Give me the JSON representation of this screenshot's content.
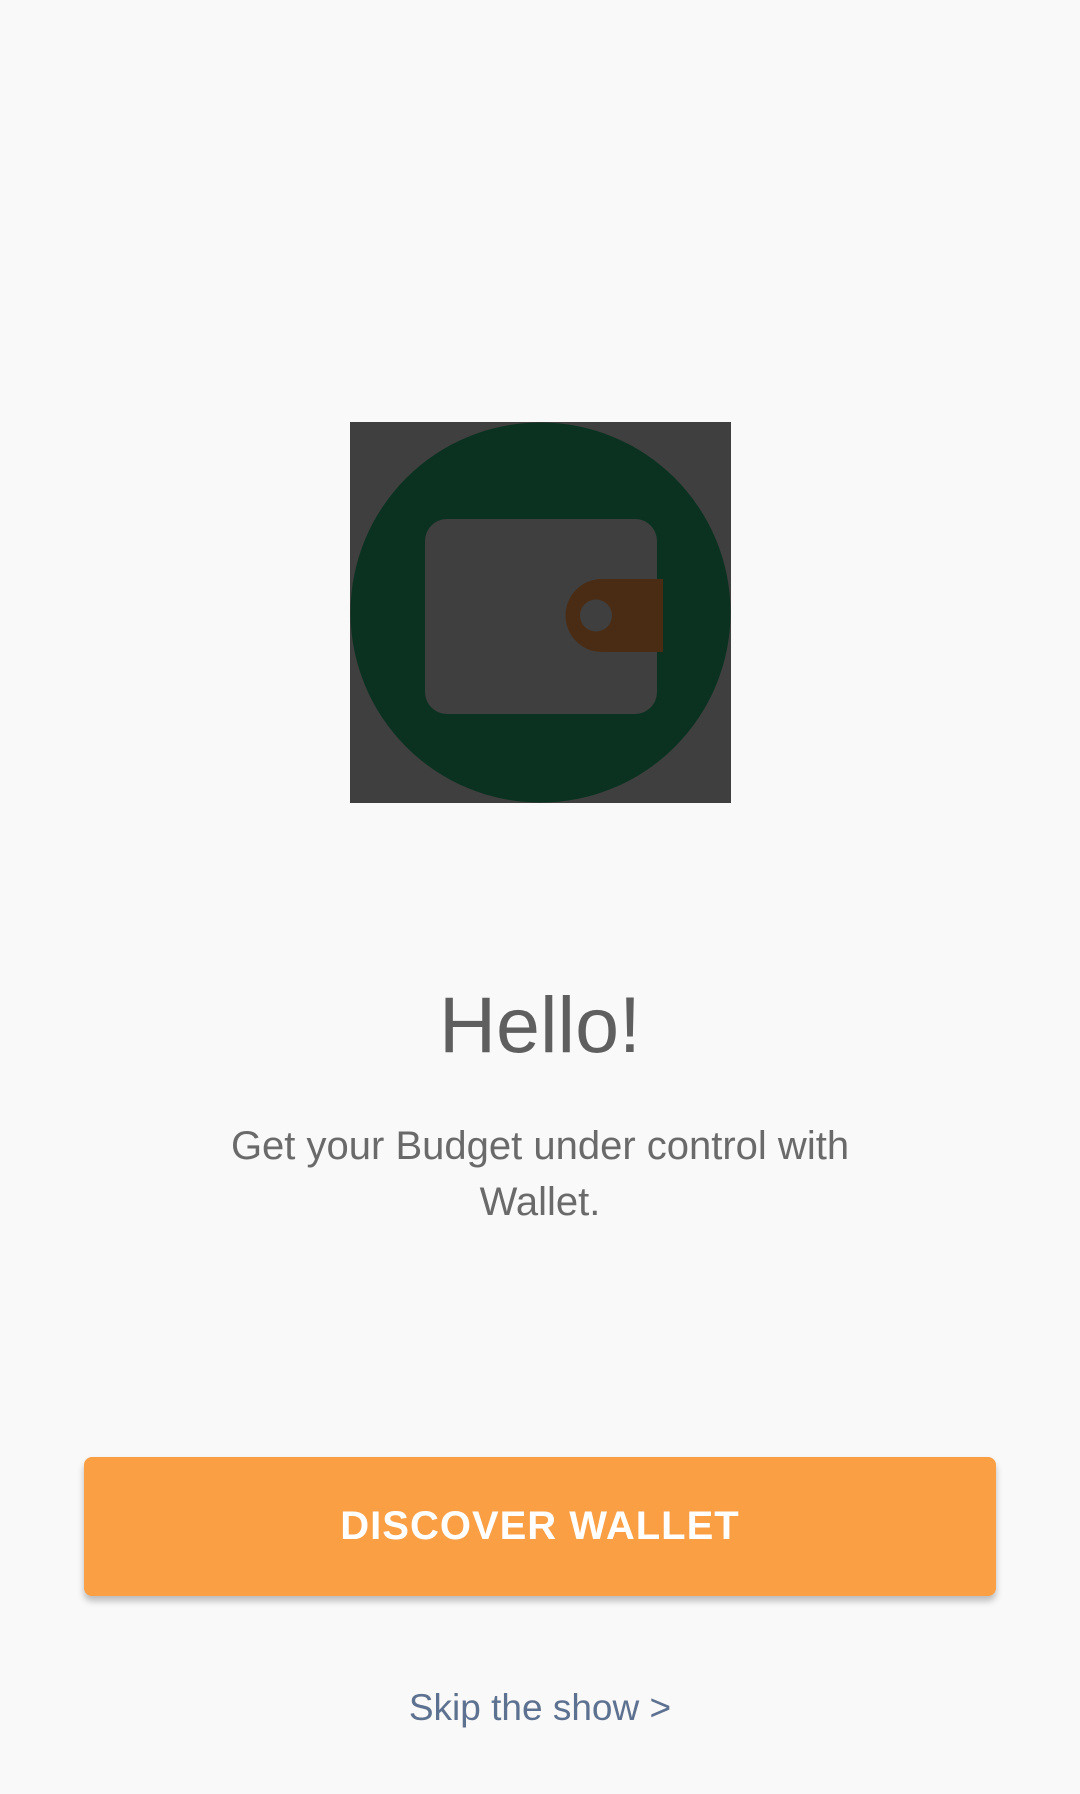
{
  "hero": {
    "icon": "wallet-icon",
    "colors": {
      "backdrop": "#3f3f3f",
      "circle": "#0b3221",
      "wallet_body": "#3f3f3f",
      "clasp": "#4a2c14"
    }
  },
  "welcome": {
    "title": "Hello!",
    "subtitle": "Get your Budget under control with Wallet."
  },
  "actions": {
    "discover_label": "DISCOVER WALLET",
    "skip_label": "Skip the show >"
  },
  "colors": {
    "background": "#f9f9f9",
    "accent": "#fb9f45",
    "link": "#5d7190"
  }
}
